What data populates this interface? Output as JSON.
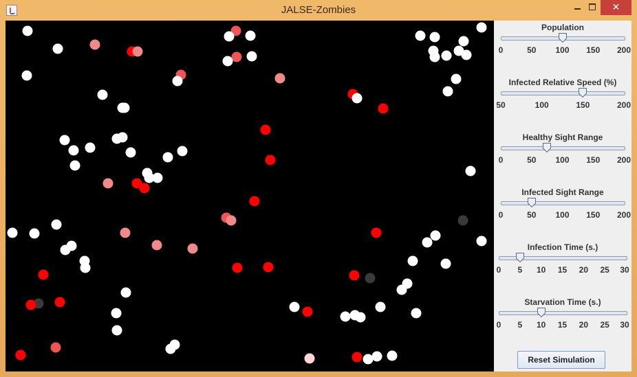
{
  "window": {
    "title": "JALSE-Zombies",
    "close_glyph": "✕",
    "icons": [
      "java-app-icon",
      "minimize-icon",
      "maximize-icon",
      "close-icon"
    ]
  },
  "controls": {
    "sliders": [
      {
        "label": "Population",
        "min": 0,
        "max": 200,
        "value": 100,
        "ticks": [
          "0",
          "50",
          "100",
          "150",
          "200"
        ]
      },
      {
        "label": "Infected Relative Speed (%)",
        "min": 50,
        "max": 200,
        "value": 150,
        "ticks": [
          "50",
          "100",
          "150",
          "200"
        ]
      },
      {
        "label": "Healthy Sight Range",
        "min": 0,
        "max": 200,
        "value": 75,
        "ticks": [
          "0",
          "50",
          "100",
          "150",
          "200"
        ]
      },
      {
        "label": "Infected Sight Range",
        "min": 0,
        "max": 200,
        "value": 50,
        "ticks": [
          "0",
          "50",
          "100",
          "150",
          "200"
        ]
      },
      {
        "label": "Infection Time (s.)",
        "min": 0,
        "max": 30,
        "value": 5,
        "ticks": [
          "0",
          "5",
          "10",
          "15",
          "20",
          "25",
          "30"
        ]
      },
      {
        "label": "Starvation Time (s.)",
        "min": 0,
        "max": 30,
        "value": 10,
        "ticks": [
          "0",
          "5",
          "10",
          "15",
          "20",
          "25",
          "30"
        ]
      }
    ],
    "reset_label": "Reset Simulation"
  },
  "simulation": {
    "colors": {
      "background": "#000000",
      "healthy": "#ffffff",
      "infected": "#ff0000",
      "recovering": "#ee5555",
      "incubating": "#f08a8a",
      "early": "#ffd5d5",
      "starved": "#3a3a3a"
    }
  }
}
